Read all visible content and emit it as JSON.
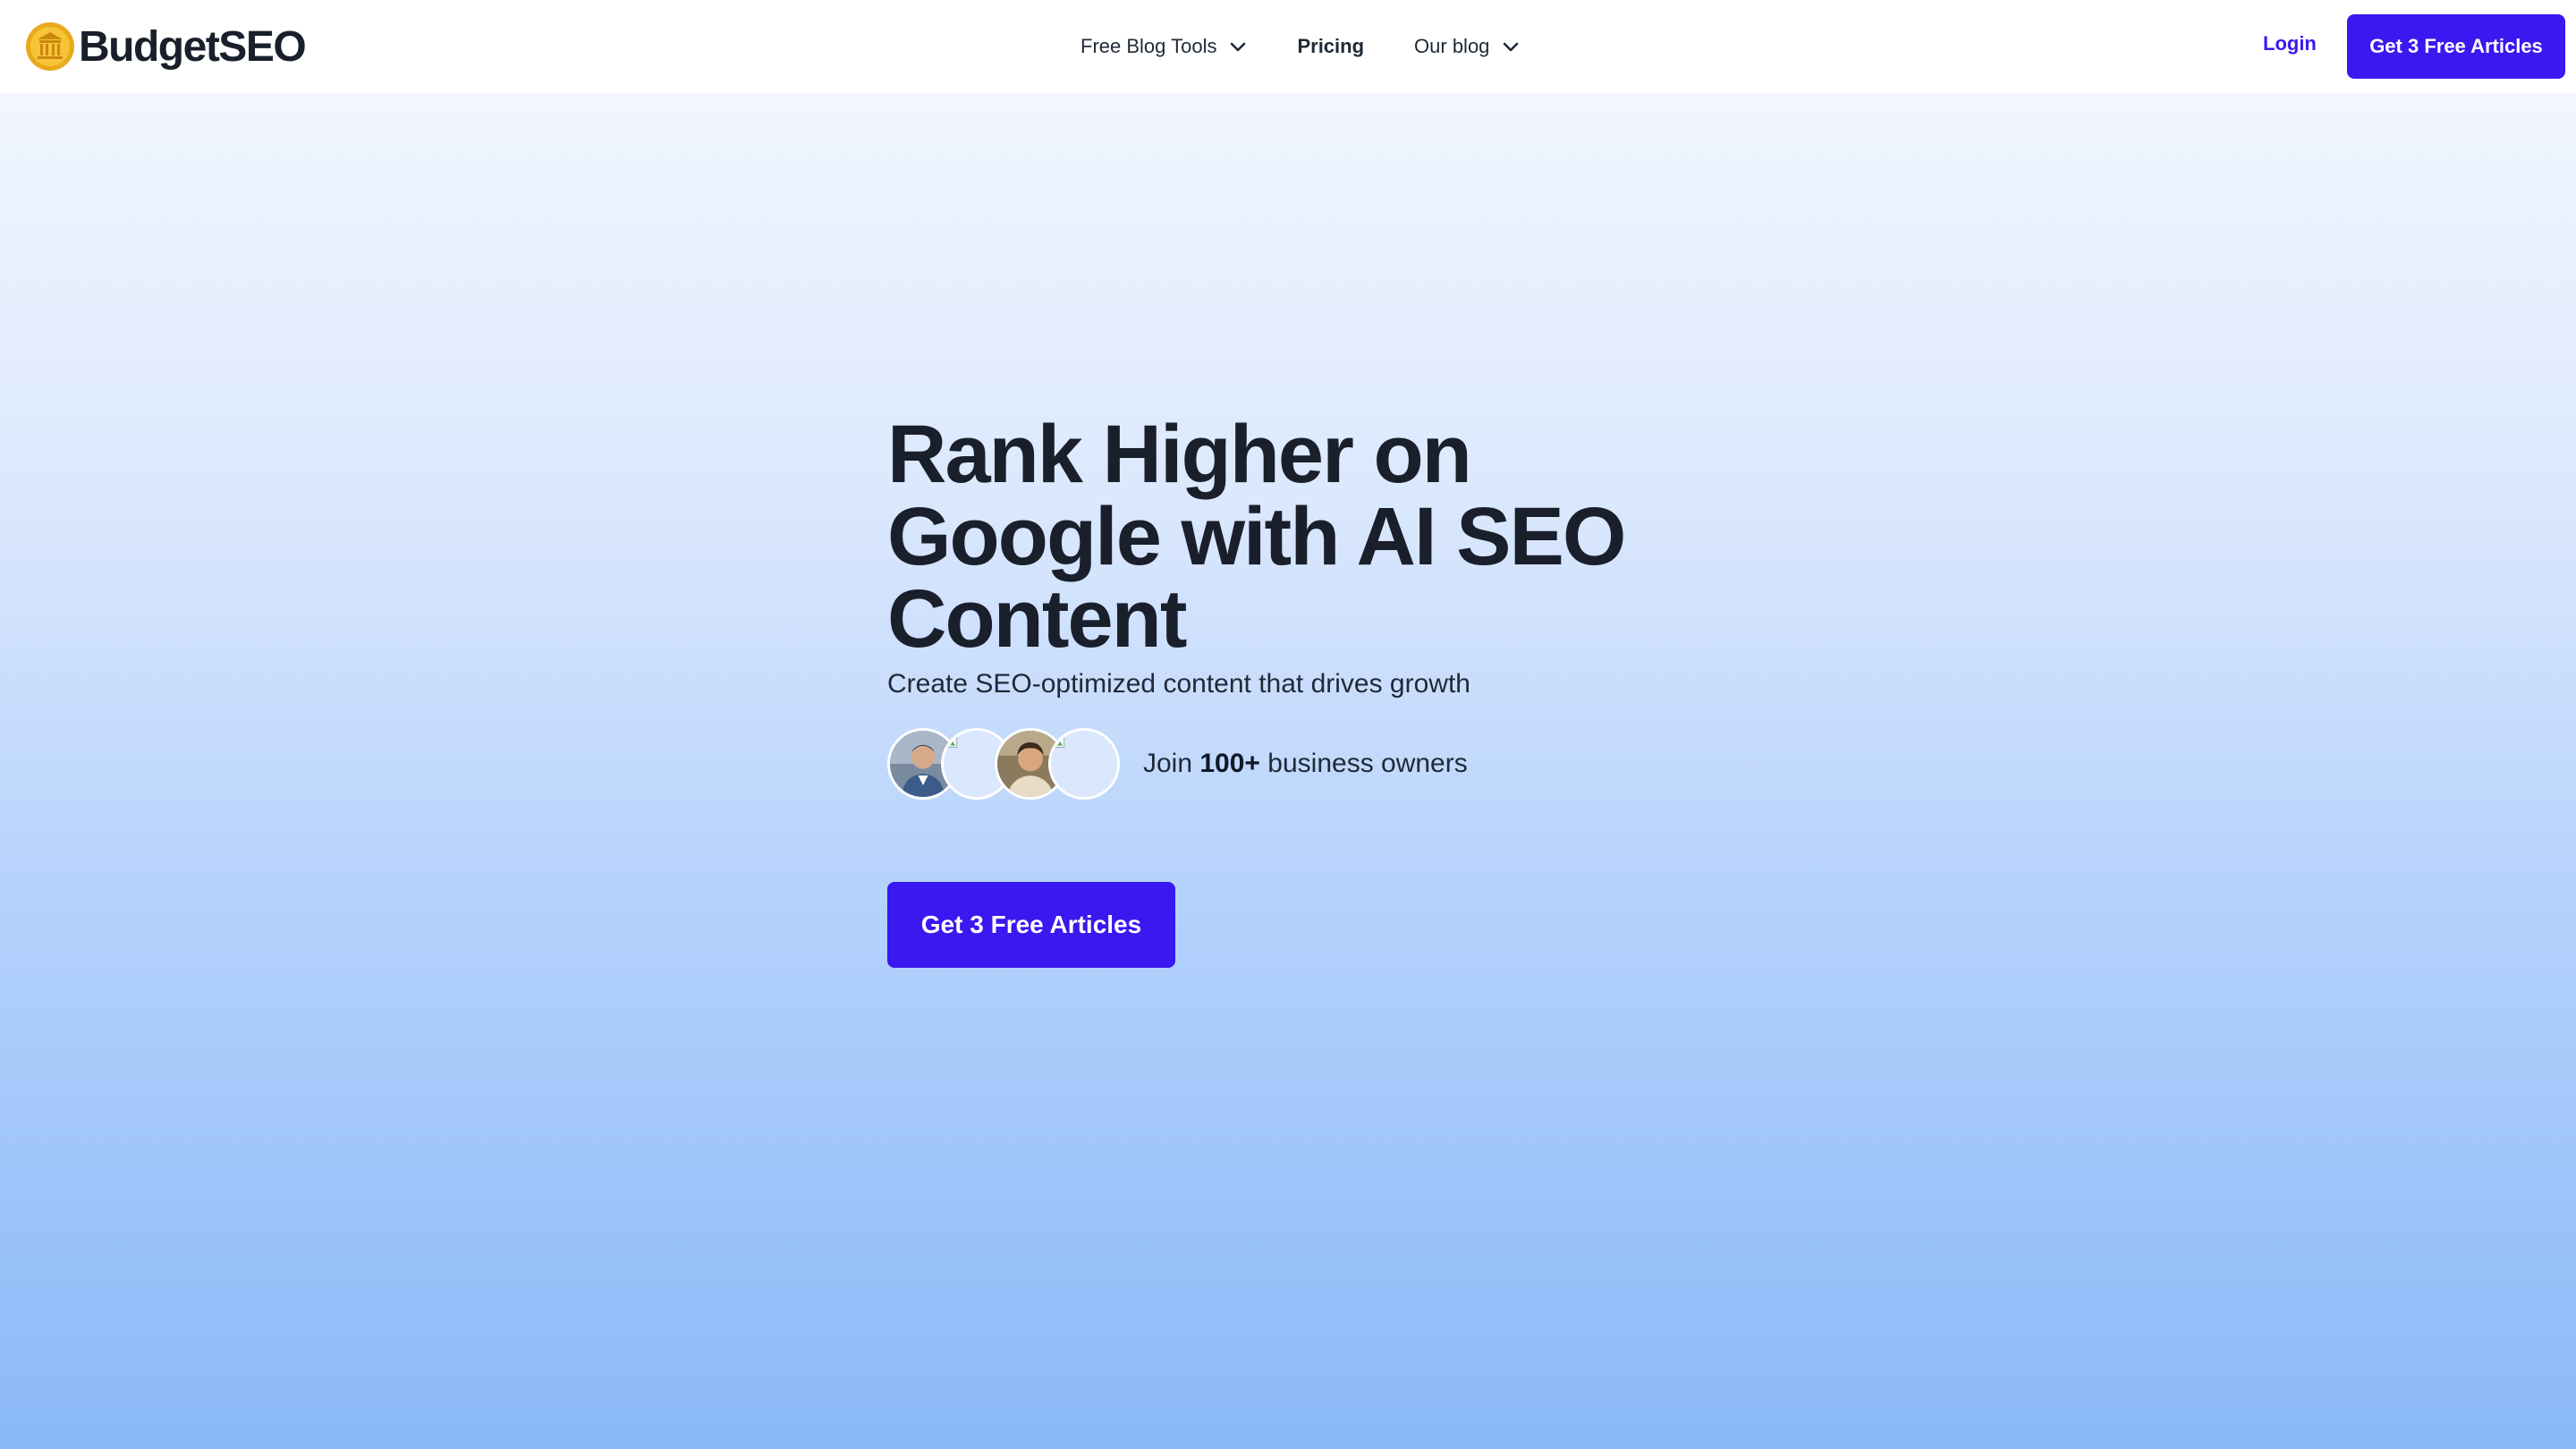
{
  "brand": {
    "name": "BudgetSEO",
    "logo_icon": "coin-bank-icon",
    "accent_color": "#3a18f0"
  },
  "nav": {
    "items": [
      {
        "label": "Free Blog Tools",
        "has_dropdown": true
      },
      {
        "label": "Pricing",
        "has_dropdown": false
      },
      {
        "label": "Our blog",
        "has_dropdown": true
      }
    ],
    "login_label": "Login",
    "cta_label": "Get 3 Free Articles"
  },
  "hero": {
    "title": "Rank Higher on Google with AI SEO Content",
    "subtitle": "Create SEO-optimized content that drives growth",
    "social_proof": {
      "prefix": "Join ",
      "count": "100+",
      "suffix": " business owners",
      "avatar_count": 4
    },
    "cta_label": "Get 3 Free Articles"
  }
}
